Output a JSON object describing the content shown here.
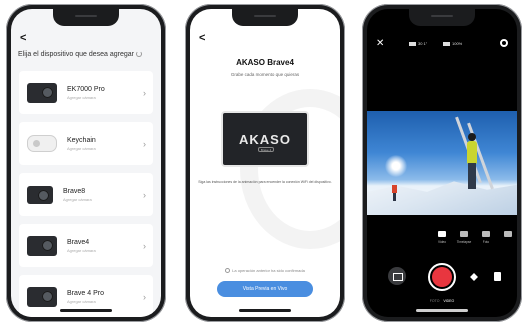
{
  "screen1": {
    "back": "<",
    "header": "Elija el dispositivo que desea agregar",
    "devices": [
      {
        "name": "EK7000 Pro",
        "sub": "Agregar cámara"
      },
      {
        "name": "Keychain",
        "sub": "Agregar cámara"
      },
      {
        "name": "Brave8",
        "sub": "Agregar cámara"
      },
      {
        "name": "Brave4",
        "sub": "Agregar cámara"
      },
      {
        "name": "Brave 4 Pro",
        "sub": "Agregar cámara"
      }
    ],
    "chevron": "›"
  },
  "screen2": {
    "back": "<",
    "title": "AKASO Brave4",
    "description": "Grabe cada momento que quieras",
    "logo": "AKASO",
    "model": "Brave 4",
    "instructions": "Siga las instrucciones de la animación para encender la conexión WiFi del dispositivo.",
    "checkbox_label": "La operación anterior ha sido confirmada",
    "button": "Vista Previa en Vivo"
  },
  "screen3": {
    "close": "✕",
    "status_left": "30   1\"",
    "status_right": "100%",
    "modes": [
      {
        "label": "Video"
      },
      {
        "label": "Timelapse"
      },
      {
        "label": "Foto"
      },
      {
        "label": ""
      }
    ],
    "record_labels": [
      "FOTO",
      "VIDEO"
    ]
  }
}
